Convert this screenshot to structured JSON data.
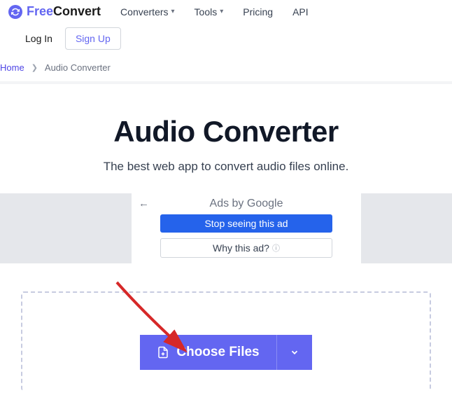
{
  "logo": {
    "free": "Free",
    "convert": "Convert"
  },
  "nav": {
    "converters": "Converters",
    "tools": "Tools",
    "pricing": "Pricing",
    "api": "API"
  },
  "auth": {
    "login": "Log In",
    "signup": "Sign Up"
  },
  "breadcrumb": {
    "home": "Home",
    "current": "Audio Converter"
  },
  "hero": {
    "title": "Audio Converter",
    "subtitle": "The best web app to convert audio files online."
  },
  "ad": {
    "byline": "Ads by Google",
    "stop": "Stop seeing this ad",
    "why": "Why this ad?"
  },
  "upload": {
    "choose": "Choose Files"
  }
}
